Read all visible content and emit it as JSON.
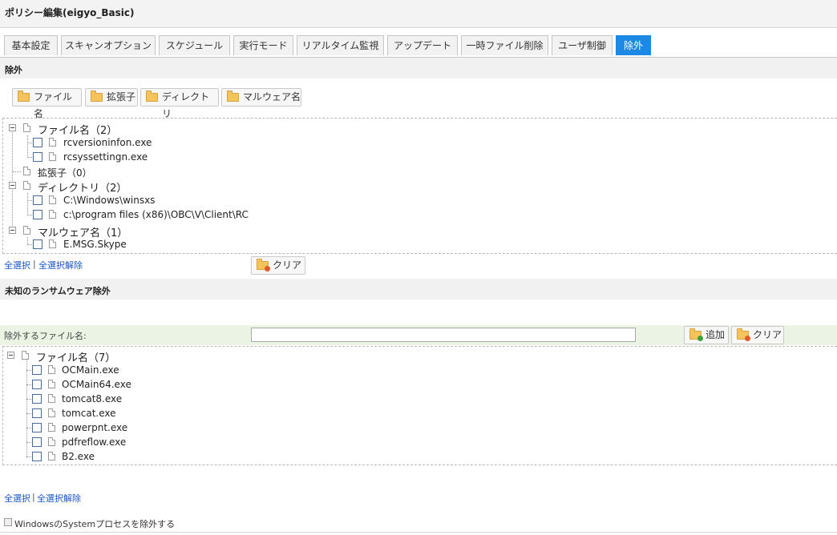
{
  "window": {
    "title": "ポリシー編集(eigyo_Basic)"
  },
  "tabs": [
    {
      "label": "基本設定",
      "active": false
    },
    {
      "label": "スキャンオプション",
      "active": false
    },
    {
      "label": "スケジュール",
      "active": false
    },
    {
      "label": "実行モード",
      "active": false
    },
    {
      "label": "リアルタイム監視",
      "active": false
    },
    {
      "label": "アップデート",
      "active": false
    },
    {
      "label": "一時ファイル削除",
      "active": false
    },
    {
      "label": "ユーザ制御",
      "active": false
    },
    {
      "label": "除外",
      "active": true
    }
  ],
  "exclusion": {
    "heading": "除外",
    "buttons": {
      "filename": "ファイル名",
      "extension": "拡張子",
      "directory": "ディレクトリ",
      "malware": "マルウェア名"
    },
    "tree": {
      "filename_group": "ファイル名（2）",
      "filenames": [
        "rcversioninfon.exe",
        "rcsyssettingn.exe"
      ],
      "extension_group": "拡張子（0）",
      "directory_group": "ディレクトリ（2）",
      "directories": [
        "C:\\Windows\\winsxs",
        "c:\\program files (x86)\\OBC\\V\\Client\\RC"
      ],
      "malware_group": "マルウェア名（1）",
      "malwares": [
        "E.MSG.Skype"
      ]
    },
    "select_all": "全選択",
    "separator": "|",
    "deselect_all": "全選択解除",
    "clear": "クリア"
  },
  "ransomware": {
    "heading": "未知のランサムウェア除外",
    "input_label": "除外するファイル名:",
    "input_value": "",
    "add": "追加",
    "clear": "クリア",
    "tree": {
      "group": "ファイル名（7）",
      "files": [
        "OCMain.exe",
        "OCMain64.exe",
        "tomcat8.exe",
        "tomcat.exe",
        "powerpnt.exe",
        "pdfreflow.exe",
        "B2.exe"
      ]
    },
    "select_all": "全選択",
    "separator": "|",
    "deselect_all": "全選択解除"
  },
  "system_process": {
    "label": "WindowsのSystemプロセスを除外する",
    "checked": false
  },
  "colors": {
    "active_tab": "#1e88e5",
    "link": "#1a56c8",
    "input_row": "#eaf3e4"
  },
  "icons": [
    "folder-icon",
    "document-icon",
    "tree-toggle-icon",
    "clear-icon",
    "add-icon"
  ]
}
